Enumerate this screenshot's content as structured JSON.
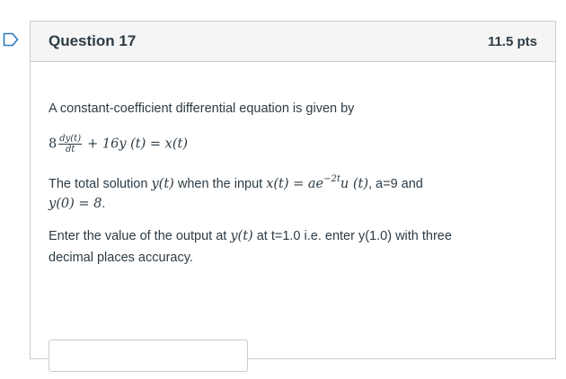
{
  "question": {
    "title": "Question 17",
    "points": "11.5 pts",
    "intro": "A constant-coefficient differential equation is given by",
    "equation": {
      "coef": "8",
      "frac_num": "dy(t)",
      "frac_den": "dt",
      "rest": "+ 16y (t) = x(t)"
    },
    "line2": {
      "prefix": "The  total solution",
      "yt": "y(t)",
      "mid": "when  the input",
      "xt_lhs": "x(t) = ae",
      "exponent": "−2t",
      "ut": "u (t)",
      "suffix": ", a=9  and"
    },
    "line3": {
      "ic": "y(0) = 8",
      "end": "."
    },
    "line4": {
      "part1": "Enter the value of the output at",
      "yt": "y(t)",
      "part2": "at  t=1.0   i.e. enter   y(1.0)  with three"
    },
    "line5": "decimal places accuracy.",
    "answer_value": ""
  },
  "colors": {
    "text": "#2d3b45",
    "border": "#c7cdd1",
    "header_bg": "#f5f5f5",
    "flag": "#2b7abc"
  }
}
